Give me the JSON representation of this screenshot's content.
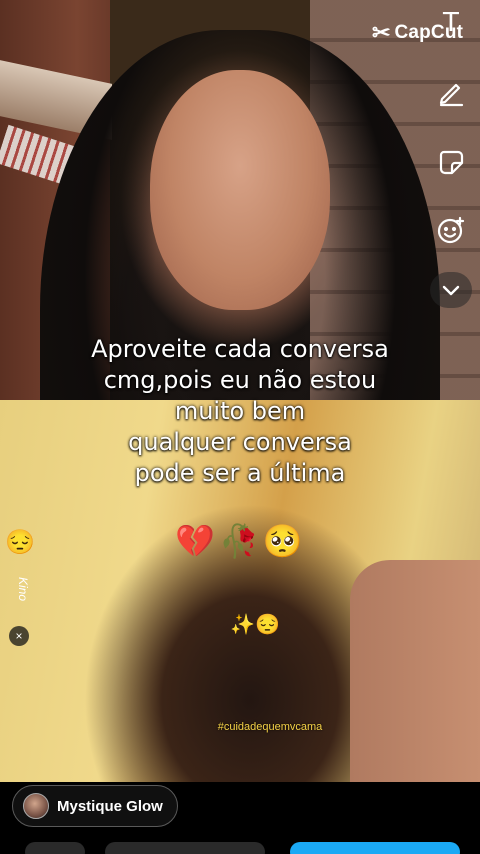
{
  "app": {
    "brand": "CapCut",
    "brand_icon": "capcut-logo-icon"
  },
  "toolbar": {
    "text_tool_glyph": "T",
    "icons": [
      "text-icon",
      "pen-icon",
      "sticker-icon",
      "effect-icon",
      "chevron-down-icon"
    ]
  },
  "caption": {
    "lines": [
      "Aproveite cada conversa",
      "cmg,pois eu não estou",
      "muito bem",
      "qualquer conversa",
      "pode ser a última"
    ],
    "emojis": "💔🥀🥺",
    "emojis_2": "✨😔",
    "hashtag": "#cuidadequemvcama"
  },
  "side_tag": {
    "emoji": "😔",
    "label": "Kino",
    "close": "×"
  },
  "bottom": {
    "chip_label": "Mystique Glow",
    "accent": "#1ba9f5"
  }
}
